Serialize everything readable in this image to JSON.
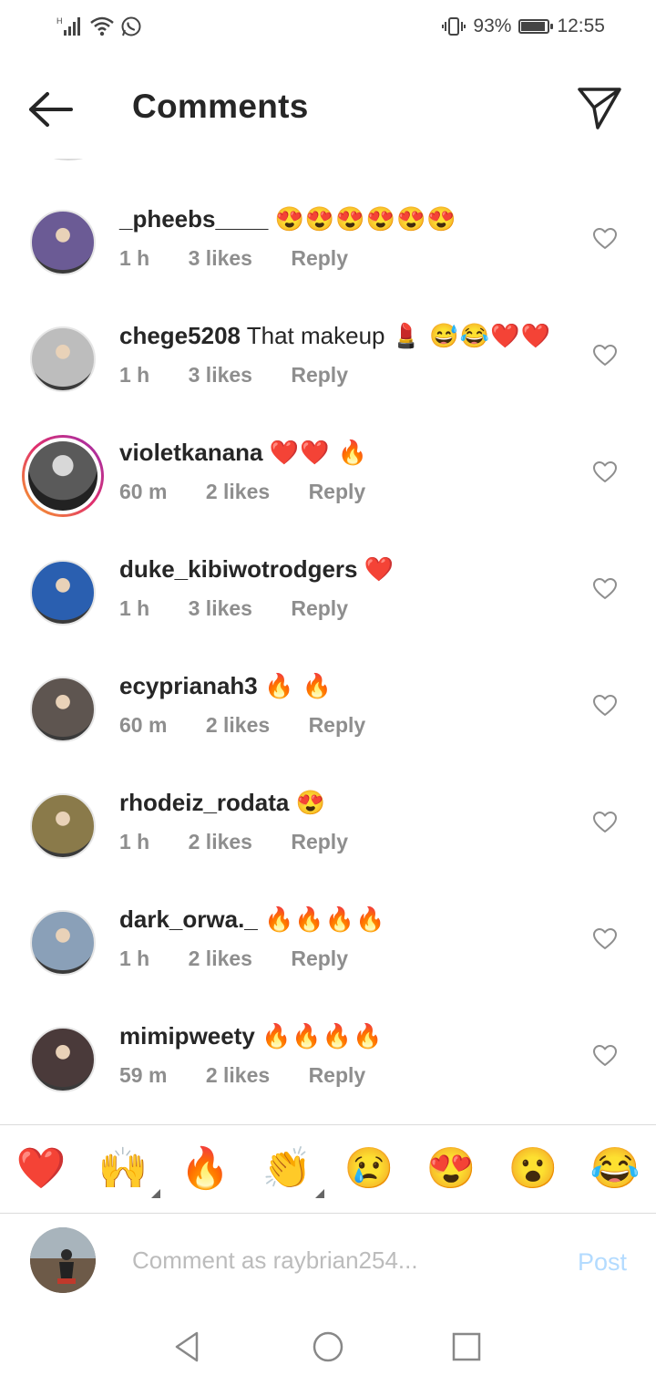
{
  "status_bar": {
    "signal_label": "H",
    "battery": "93%",
    "battery_level": 0.93,
    "time": "12:55"
  },
  "header": {
    "title": "Comments",
    "back_icon": "arrow-left-icon",
    "share_icon": "paper-plane-icon"
  },
  "comments": [
    {
      "username": "_pheebs____",
      "text": "",
      "emoji": "😍😍😍😍😍😍",
      "time": "1 h",
      "likes": "3 likes",
      "reply": "Reply",
      "avatar_color": "#6b5b95",
      "story": false
    },
    {
      "username": "chege5208",
      "text": "That makeup ",
      "emoji": "💄 😅😂❤️❤️",
      "time": "1 h",
      "likes": "3 likes",
      "reply": "Reply",
      "avatar_color": "#bdbdbd",
      "story": false
    },
    {
      "username": "violetkanana",
      "text": "",
      "emoji": "❤️❤️ 🔥",
      "time": "60 m",
      "likes": "2 likes",
      "reply": "Reply",
      "avatar_color": "#5a5a5a",
      "story": true
    },
    {
      "username": "duke_kibiwotrodgers",
      "text": "",
      "emoji": "❤️",
      "time": "1 h",
      "likes": "3 likes",
      "reply": "Reply",
      "avatar_color": "#2a5fb0",
      "story": false
    },
    {
      "username": "ecyprianah3",
      "text": "",
      "emoji": "🔥 🔥",
      "time": "60 m",
      "likes": "2 likes",
      "reply": "Reply",
      "avatar_color": "#5e5550",
      "story": false
    },
    {
      "username": "rhodeiz_rodata",
      "text": "",
      "emoji": "😍",
      "time": "1 h",
      "likes": "2 likes",
      "reply": "Reply",
      "avatar_color": "#8a7a4a",
      "story": false
    },
    {
      "username": "dark_orwa._",
      "text": "",
      "emoji": "🔥🔥🔥🔥",
      "time": "1 h",
      "likes": "2 likes",
      "reply": "Reply",
      "avatar_color": "#8aa0b8",
      "story": false
    },
    {
      "username": "mimipweety",
      "text": "",
      "emoji": "🔥🔥🔥🔥",
      "time": "59 m",
      "likes": "2 likes",
      "reply": "Reply",
      "avatar_color": "#4a3a3a",
      "story": false
    }
  ],
  "quick_reactions": [
    "❤️",
    "🙌",
    "🔥",
    "👏",
    "😢",
    "😍",
    "😮",
    "😂"
  ],
  "composer": {
    "placeholder": "Comment as raybrian254...",
    "post_label": "Post"
  },
  "colors": {
    "text": "#262626",
    "meta": "#8e8e8e",
    "post_disabled": "#b3dbff"
  }
}
